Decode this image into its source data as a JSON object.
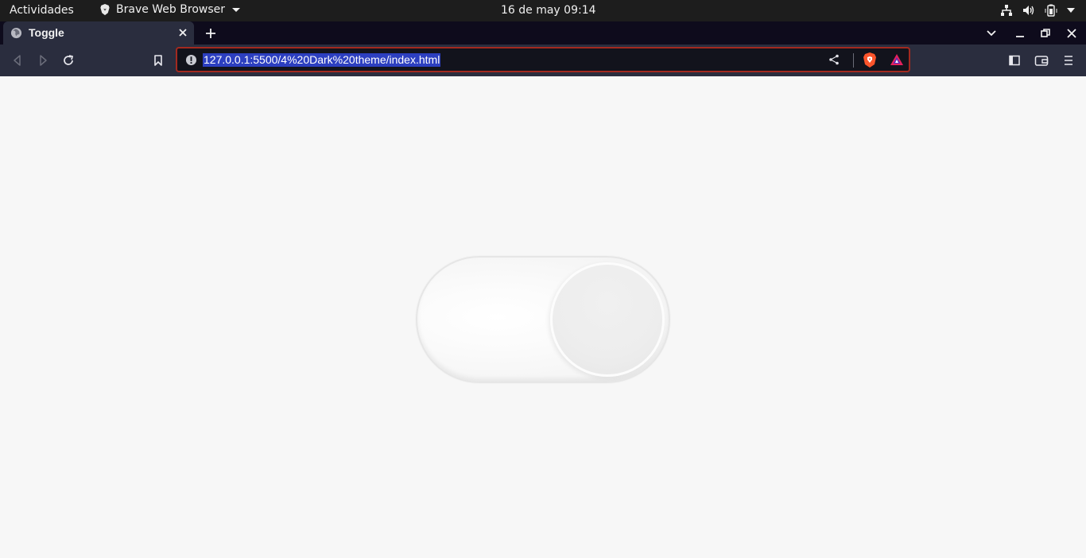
{
  "os_bar": {
    "activities": "Actividades",
    "app_name": "Brave Web Browser",
    "clock": "16 de may  09:14"
  },
  "tabs": [
    {
      "title": "Toggle",
      "active": true
    }
  ],
  "address_bar": {
    "url": "127.0.0.1:5500/4%20Dark%20theme/index.html",
    "selected": true
  },
  "page": {
    "toggle": {
      "state": "on",
      "track_color": "#ffffff",
      "knob_color": "#eeeeee"
    }
  },
  "colors": {
    "accent_border": "#a3291f",
    "selection": "#2c3fc0",
    "toolbar": "#2a2d3e",
    "tabstrip": "#0e0b1c",
    "page_bg": "#f7f7f7"
  }
}
